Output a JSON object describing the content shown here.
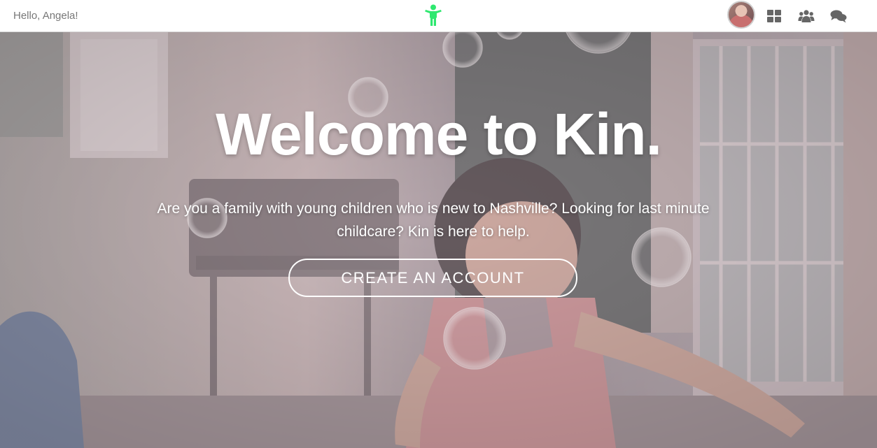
{
  "header": {
    "greeting": "Hello, Angela!",
    "logo_icon": "child-figure-icon",
    "logo_color": "#2ee86f",
    "nav_icons": [
      "dashboard-grid-icon",
      "group-users-icon",
      "chat-bubbles-icon"
    ],
    "icon_color": "#666666"
  },
  "hero": {
    "title": "Welcome to Kin.",
    "subtitle": "Are you a family with young children who is new to Nashville? Looking for last minute childcare? Kin is here to help.",
    "cta_label": "CREATE AN ACCOUNT",
    "background_description_icon": "child-playing-bubbles-photo"
  }
}
